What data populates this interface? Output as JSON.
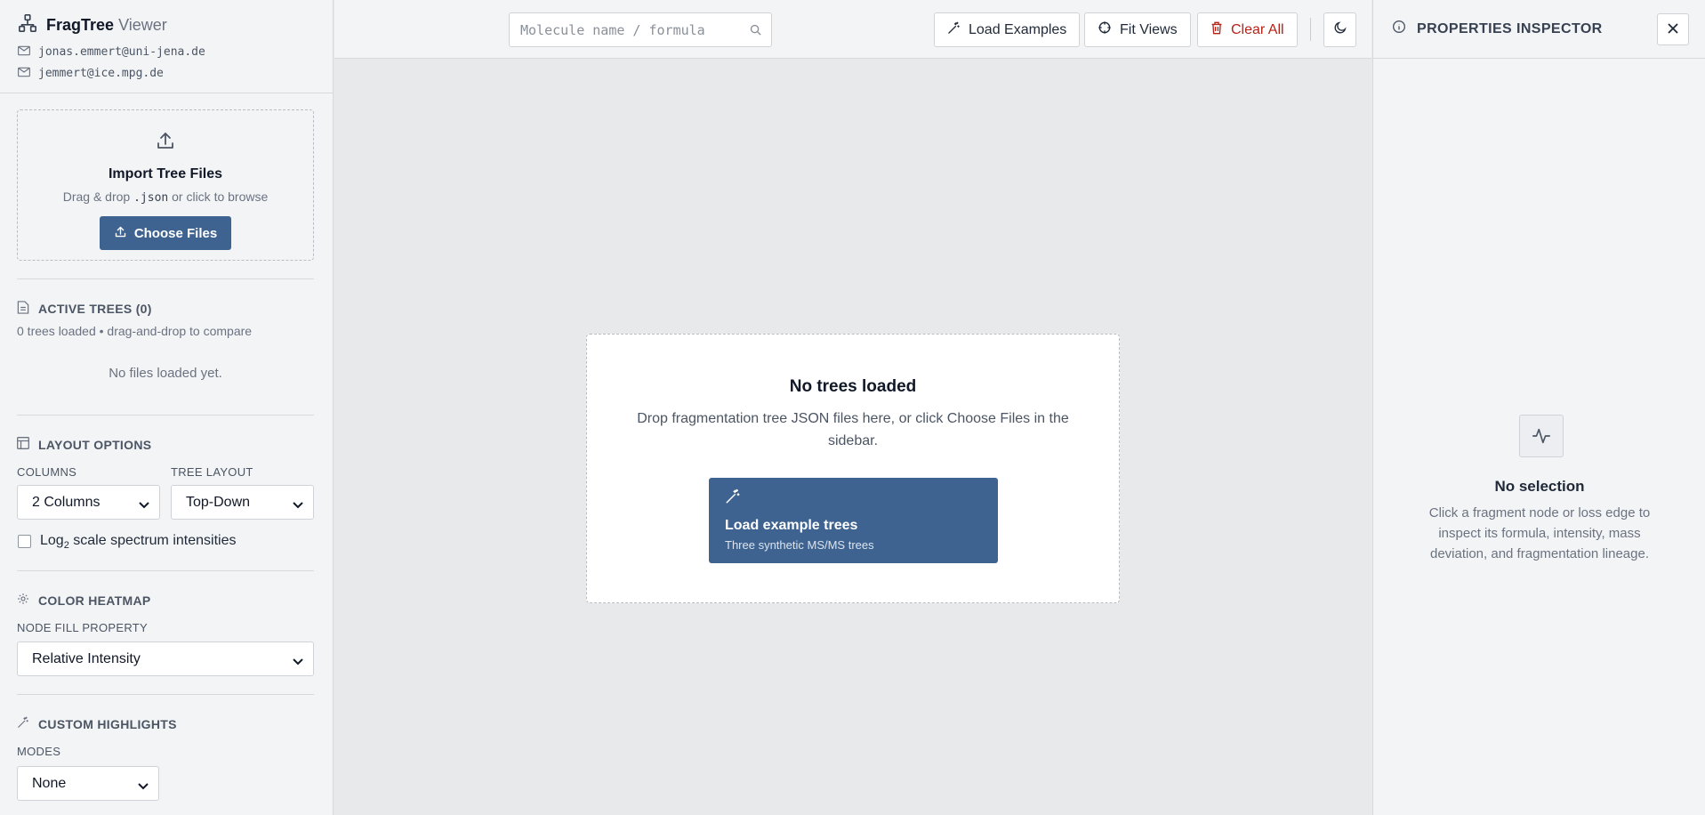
{
  "sidebar": {
    "brand_bold": "FragTree",
    "brand_light": "Viewer",
    "emails": [
      "jonas.emmert@uni-jena.de",
      "jemmert@ice.mpg.de"
    ],
    "import": {
      "title": "Import Tree Files",
      "sub_before": "Drag & drop",
      "sub_code": ".json",
      "sub_after": "or click to browse",
      "button": "Choose Files"
    },
    "active_trees": {
      "heading": "ACTIVE TREES (0)",
      "summary": "0 trees loaded • drag-and-drop to compare",
      "empty": "No files loaded yet."
    },
    "layout": {
      "heading": "LAYOUT OPTIONS",
      "columns_label": "COLUMNS",
      "columns_value": "2 Columns",
      "tree_layout_label": "TREE LAYOUT",
      "tree_layout_value": "Top-Down",
      "log_label_pre": "Log",
      "log_label_sub": "2",
      "log_label_post": " scale spectrum intensities",
      "log_checked": false
    },
    "heatmap": {
      "heading": "COLOR HEATMAP",
      "property_label": "NODE FILL PROPERTY",
      "property_value": "Relative Intensity"
    },
    "highlights": {
      "heading": "CUSTOM HIGHLIGHTS",
      "modes_label": "MODES",
      "modes_value": "None"
    }
  },
  "toolbar": {
    "search_placeholder": "Molecule name / formula",
    "load_examples": "Load Examples",
    "fit_views": "Fit Views",
    "clear_all": "Clear All"
  },
  "canvas": {
    "title": "No trees loaded",
    "text": "Drop fragmentation tree JSON files here, or click Choose Files in the sidebar.",
    "example_title": "Load example trees",
    "example_sub": "Three synthetic MS/MS trees"
  },
  "inspector": {
    "title": "PROPERTIES INSPECTOR",
    "empty_title": "No selection",
    "empty_text": "Click a fragment node or loss edge to inspect its formula, intensity, mass deviation, and fragmentation lineage."
  },
  "colors": {
    "primary": "#3e6390",
    "danger": "#b42318",
    "panel": "#f3f4f6",
    "canvas": "#e8e9eb"
  }
}
